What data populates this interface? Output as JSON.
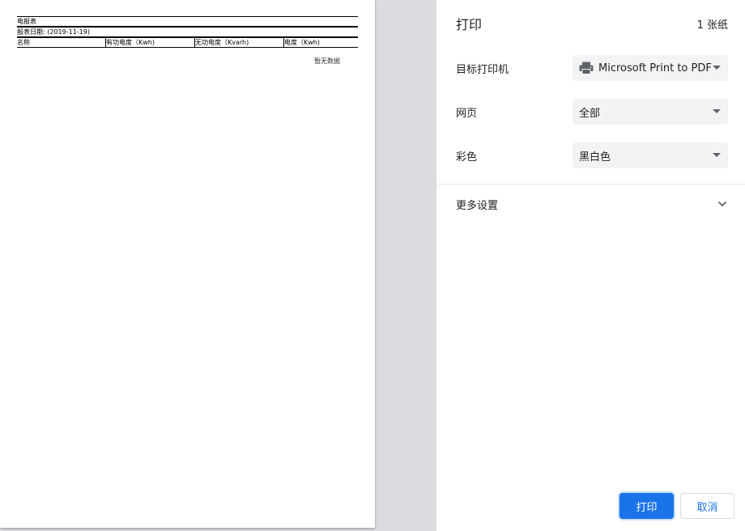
{
  "preview": {
    "report_title": "电报表",
    "report_date": "报表日期: (2019-11-19)",
    "columns": [
      "名称",
      "有功电度（Kwh)",
      "无功电度（Kvarh)",
      "电度（Kwh)"
    ],
    "no_data": "暂无数据"
  },
  "settings": {
    "title": "打印",
    "sheet_count": "1 张纸",
    "destination": {
      "label": "目标打印机",
      "value": "Microsoft Print to PDF",
      "icon": "printer-icon"
    },
    "pages": {
      "label": "网页",
      "value": "全部"
    },
    "color": {
      "label": "彩色",
      "value": "黑白色"
    },
    "more_settings": {
      "label": "更多设置",
      "icon": "chevron-down-icon"
    },
    "print_button": "打印",
    "cancel_button": "取消"
  },
  "colors": {
    "accent": "#1a73e8",
    "preview_bg": "#dadce0",
    "select_bg": "#f1f3f4"
  }
}
